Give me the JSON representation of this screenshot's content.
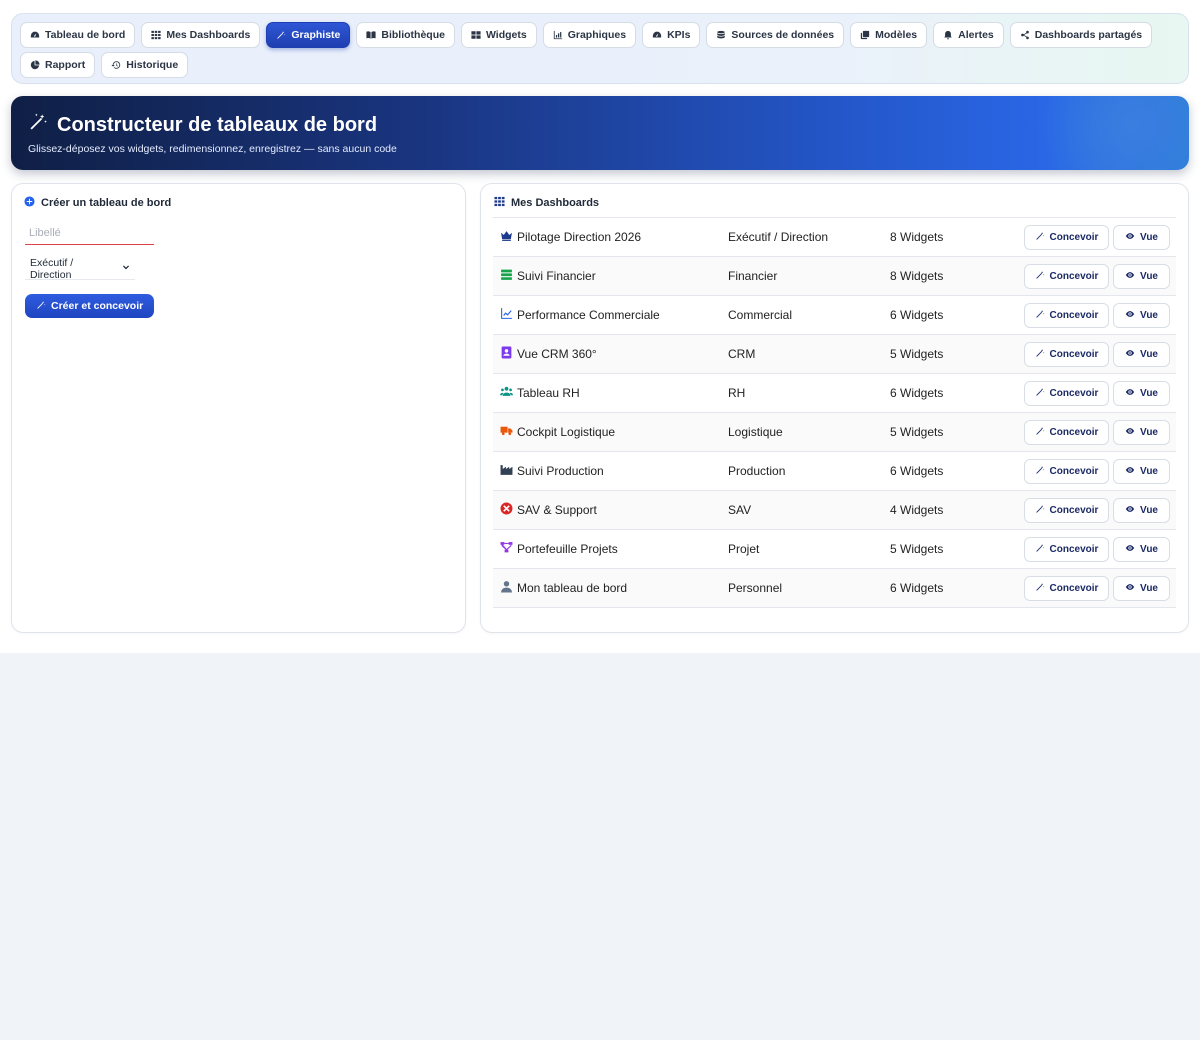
{
  "nav": {
    "tabs": [
      {
        "label": "Tableau de bord",
        "icon": "gauge-icon",
        "name": "tab-tableau-de-bord"
      },
      {
        "label": "Mes Dashboards",
        "icon": "grid-icon",
        "name": "tab-mes-dashboards"
      },
      {
        "label": "Graphiste",
        "icon": "magic-wand-icon",
        "name": "tab-graphiste",
        "active": true
      },
      {
        "label": "Bibliothèque",
        "icon": "book-icon",
        "name": "tab-bibliotheque"
      },
      {
        "label": "Widgets",
        "icon": "widgets-icon",
        "name": "tab-widgets"
      },
      {
        "label": "Graphiques",
        "icon": "chart-icon",
        "name": "tab-graphiques"
      },
      {
        "label": "KPIs",
        "icon": "gauge-icon",
        "name": "tab-kpis"
      },
      {
        "label": "Sources de données",
        "icon": "database-icon",
        "name": "tab-sources"
      },
      {
        "label": "Modèles",
        "icon": "copy-icon",
        "name": "tab-modeles"
      },
      {
        "label": "Alertes",
        "icon": "bell-icon",
        "name": "tab-alertes"
      },
      {
        "label": "Dashboards partagés",
        "icon": "share-icon",
        "name": "tab-partages"
      }
    ],
    "tabs_row2": [
      {
        "label": "Rapport",
        "icon": "pie-icon",
        "name": "tab-rapport"
      },
      {
        "label": "Historique",
        "icon": "history-icon",
        "name": "tab-historique"
      }
    ]
  },
  "banner": {
    "title": "Constructeur de tableaux de bord",
    "subtitle": "Glissez-déposez vos widgets, redimensionnez, enregistrez — sans aucun code"
  },
  "create_panel": {
    "title": "Créer un tableau de bord",
    "label_placeholder": "Libellé",
    "type_selected": "Exécutif / Direction",
    "create_button": "Créer et concevoir"
  },
  "list_panel": {
    "title": "Mes Dashboards",
    "design_label": "Concevoir",
    "view_label": "Vue",
    "rows": [
      {
        "name": "Pilotage Direction 2026",
        "category": "Exécutif / Direction",
        "widgets": "8 Widgets",
        "icon": "crown-icon",
        "color": "#1e3a8a"
      },
      {
        "name": "Suivi Financier",
        "category": "Financier",
        "widgets": "8 Widgets",
        "icon": "money-icon",
        "color": "#16a34a"
      },
      {
        "name": "Performance Commerciale",
        "category": "Commercial",
        "widgets": "6 Widgets",
        "icon": "line-chart-icon",
        "color": "#2563eb"
      },
      {
        "name": "Vue CRM 360°",
        "category": "CRM",
        "widgets": "5 Widgets",
        "icon": "contact-icon",
        "color": "#7c3aed"
      },
      {
        "name": "Tableau RH",
        "category": "RH",
        "widgets": "6 Widgets",
        "icon": "users-icon",
        "color": "#0d9488"
      },
      {
        "name": "Cockpit Logistique",
        "category": "Logistique",
        "widgets": "5 Widgets",
        "icon": "truck-icon",
        "color": "#ea580c"
      },
      {
        "name": "Suivi Production",
        "category": "Production",
        "widgets": "6 Widgets",
        "icon": "factory-icon",
        "color": "#334155"
      },
      {
        "name": "SAV & Support",
        "category": "SAV",
        "widgets": "4 Widgets",
        "icon": "lifebuoy-icon",
        "color": "#dc2626"
      },
      {
        "name": "Portefeuille Projets",
        "category": "Projet",
        "widgets": "5 Widgets",
        "icon": "sitemap-icon",
        "color": "#9333ea"
      },
      {
        "name": "Mon tableau de bord",
        "category": "Personnel",
        "widgets": "6 Widgets",
        "icon": "user-icon",
        "color": "#64748b"
      }
    ]
  },
  "colors": {
    "accent": "#1f45c0",
    "create_icon": "#2563eb",
    "grid_icon": "#1e3a8a"
  }
}
